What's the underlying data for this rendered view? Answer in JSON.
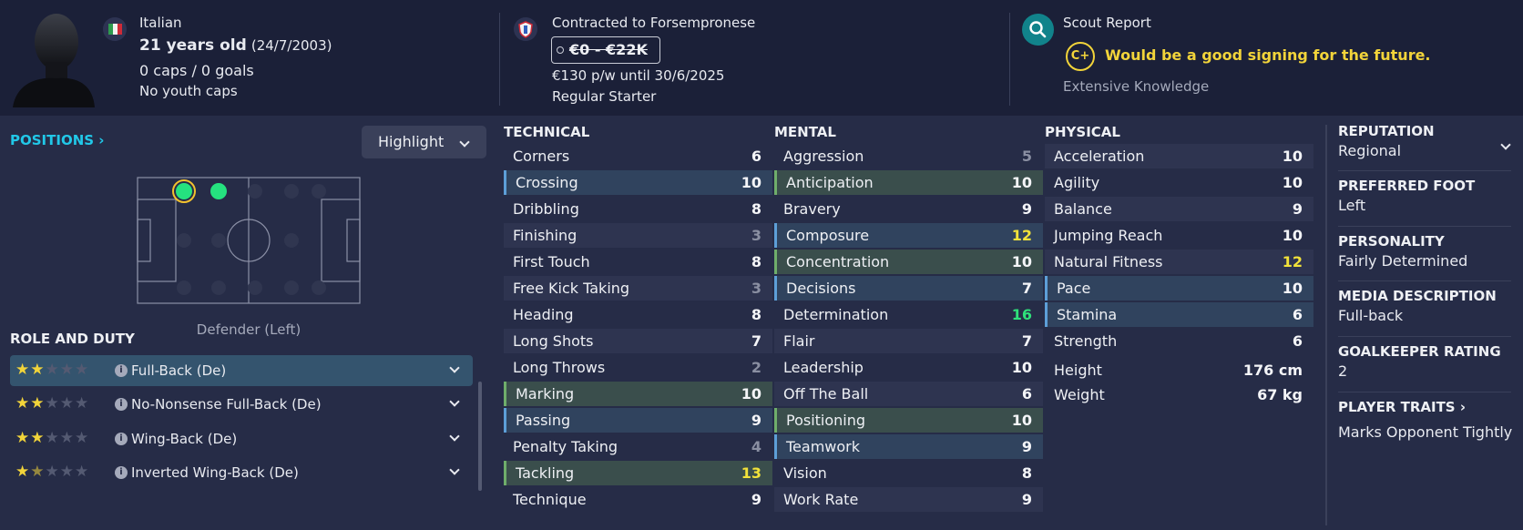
{
  "header": {
    "nationality": "Italian",
    "age": "21 years old",
    "dob": "(24/7/2003)",
    "caps_goals": "0 caps / 0 goals",
    "youth_caps": "No youth caps",
    "contract": "Contracted to Forsempronese",
    "value": "€0 - €22K",
    "wage": "€130 p/w until 30/6/2025",
    "squad_status": "Regular Starter",
    "scout_title": "Scout Report",
    "scout_grade": "C+",
    "scout_summary": "Would be a good signing for the future.",
    "scout_knowledge": "Extensive Knowledge"
  },
  "positions": {
    "link_label": "POSITIONS ›",
    "highlight_label": "Highlight",
    "caption": "Defender (Left)"
  },
  "roles": {
    "title": "ROLE AND DUTY",
    "items": [
      {
        "label": "Full-Back (De)",
        "stars": 2,
        "selected": true
      },
      {
        "label": "No-Nonsense Full-Back (De)",
        "stars": 2,
        "selected": false
      },
      {
        "label": "Wing-Back (De)",
        "stars": 2,
        "selected": false
      },
      {
        "label": "Inverted Wing-Back (De)",
        "stars": 1.5,
        "selected": false
      }
    ]
  },
  "technical": {
    "title": "TECHNICAL",
    "rows": [
      {
        "name": "Corners",
        "value": "6"
      },
      {
        "name": "Crossing",
        "value": "10"
      },
      {
        "name": "Dribbling",
        "value": "8"
      },
      {
        "name": "Finishing",
        "value": "3"
      },
      {
        "name": "First Touch",
        "value": "8"
      },
      {
        "name": "Free Kick Taking",
        "value": "3"
      },
      {
        "name": "Heading",
        "value": "8"
      },
      {
        "name": "Long Shots",
        "value": "7"
      },
      {
        "name": "Long Throws",
        "value": "2"
      },
      {
        "name": "Marking",
        "value": "10"
      },
      {
        "name": "Passing",
        "value": "9"
      },
      {
        "name": "Penalty Taking",
        "value": "4"
      },
      {
        "name": "Tackling",
        "value": "13"
      },
      {
        "name": "Technique",
        "value": "9"
      }
    ]
  },
  "mental": {
    "title": "MENTAL",
    "rows": [
      {
        "name": "Aggression",
        "value": "5"
      },
      {
        "name": "Anticipation",
        "value": "10"
      },
      {
        "name": "Bravery",
        "value": "9"
      },
      {
        "name": "Composure",
        "value": "12"
      },
      {
        "name": "Concentration",
        "value": "10"
      },
      {
        "name": "Decisions",
        "value": "7"
      },
      {
        "name": "Determination",
        "value": "16"
      },
      {
        "name": "Flair",
        "value": "7"
      },
      {
        "name": "Leadership",
        "value": "10"
      },
      {
        "name": "Off The Ball",
        "value": "6"
      },
      {
        "name": "Positioning",
        "value": "10"
      },
      {
        "name": "Teamwork",
        "value": "9"
      },
      {
        "name": "Vision",
        "value": "8"
      },
      {
        "name": "Work Rate",
        "value": "9"
      }
    ]
  },
  "physical": {
    "title": "PHYSICAL",
    "rows": [
      {
        "name": "Acceleration",
        "value": "10"
      },
      {
        "name": "Agility",
        "value": "10"
      },
      {
        "name": "Balance",
        "value": "9"
      },
      {
        "name": "Jumping Reach",
        "value": "10"
      },
      {
        "name": "Natural Fitness",
        "value": "12"
      },
      {
        "name": "Pace",
        "value": "10"
      },
      {
        "name": "Stamina",
        "value": "6"
      },
      {
        "name": "Strength",
        "value": "6"
      }
    ],
    "height_label": "Height",
    "height_value": "176 cm",
    "weight_label": "Weight",
    "weight_value": "67 kg"
  },
  "info": {
    "reputation_label": "REPUTATION",
    "reputation_value": "Regional",
    "foot_label": "PREFERRED FOOT",
    "foot_value": "Left",
    "personality_label": "PERSONALITY",
    "personality_value": "Fairly Determined",
    "media_label": "MEDIA DESCRIPTION",
    "media_value": "Full-back",
    "gk_label": "GOALKEEPER RATING",
    "gk_value": "2",
    "traits_label": "PLAYER TRAITS ›",
    "traits_value": "Marks Opponent Tightly"
  },
  "colors": {
    "accent_cyan": "#21c8e8",
    "highlight_yellow": "#f2e23a",
    "excellent_green": "#2fe07a",
    "star_gold": "#f2d43a"
  }
}
